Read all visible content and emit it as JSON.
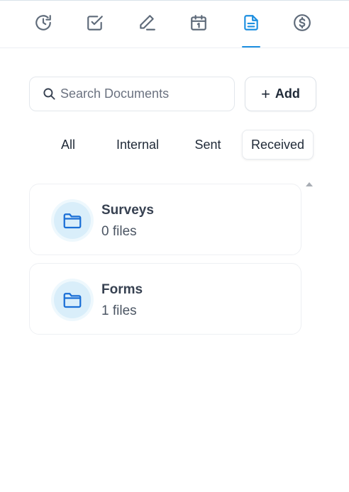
{
  "tabs": [
    {
      "icon": "history-icon",
      "active": false
    },
    {
      "icon": "checkbox-icon",
      "active": false
    },
    {
      "icon": "pen-icon",
      "active": false
    },
    {
      "icon": "calendar-icon",
      "active": false
    },
    {
      "icon": "document-icon",
      "active": true
    },
    {
      "icon": "dollar-icon",
      "active": false
    }
  ],
  "search": {
    "placeholder": "Search Documents",
    "value": ""
  },
  "add_button": {
    "label": "Add"
  },
  "filters": [
    {
      "label": "All",
      "active": false
    },
    {
      "label": "Internal",
      "active": false
    },
    {
      "label": "Sent",
      "active": false
    },
    {
      "label": "Received",
      "active": true
    }
  ],
  "folders": [
    {
      "name": "Surveys",
      "count": "0 files",
      "icon": "folder-icon"
    },
    {
      "name": "Forms",
      "count": "1 files",
      "icon": "folder-icon"
    }
  ],
  "colors": {
    "accent": "#1d8fe0",
    "icon_gray": "#5f6b7a",
    "folder_blue": "#1a6fd6"
  }
}
